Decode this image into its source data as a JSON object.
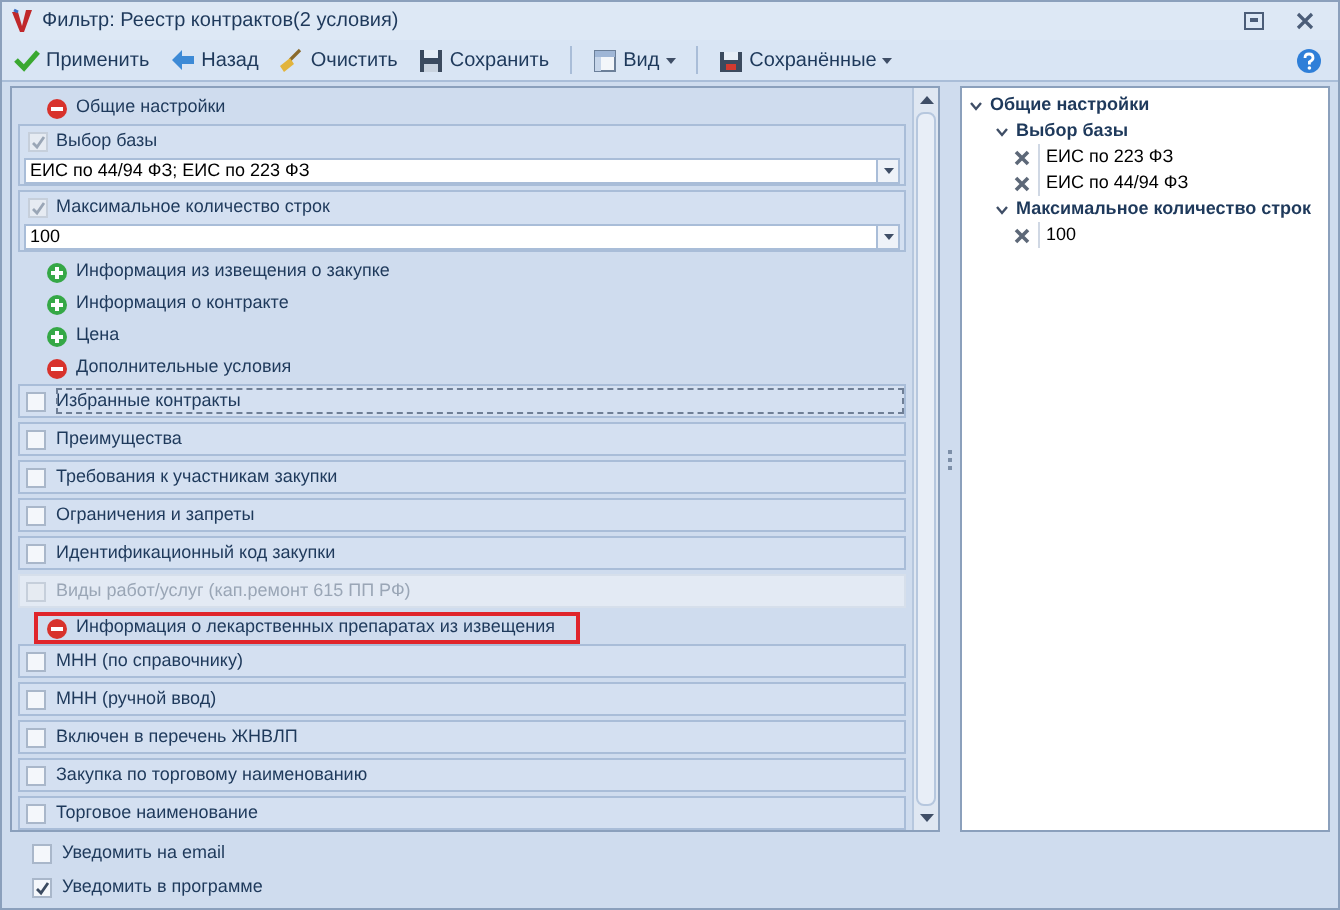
{
  "window": {
    "title": "Фильтр: Реестр контрактов(2 условия)"
  },
  "toolbar": [
    {
      "kind": "apply",
      "label": "Применить"
    },
    {
      "kind": "back",
      "label": "Назад"
    },
    {
      "kind": "clear",
      "label": "Очистить"
    },
    {
      "kind": "save",
      "label": "Сохранить"
    },
    {
      "kind": "view",
      "label": "Вид",
      "dropdown": true
    },
    {
      "kind": "saved",
      "label": "Сохранённые",
      "dropdown": true
    }
  ],
  "filters": [
    {
      "kind": "header",
      "label": "Общие настройки",
      "expanded": true,
      "highlighted": false
    },
    {
      "kind": "group",
      "label": "Выбор базы",
      "checked": true,
      "value": "ЕИС по 44/94 ФЗ; ЕИС по 223 ФЗ"
    },
    {
      "kind": "group",
      "label": "Максимальное количество строк",
      "checked": true,
      "value": "100"
    },
    {
      "kind": "header",
      "label": "Информация из извещения о закупке",
      "expanded": false,
      "highlighted": false
    },
    {
      "kind": "header",
      "label": "Информация о контракте",
      "expanded": false,
      "highlighted": false
    },
    {
      "kind": "header",
      "label": "Цена",
      "expanded": false,
      "highlighted": false
    },
    {
      "kind": "header",
      "label": "Дополнительные условия",
      "expanded": true,
      "highlighted": false
    },
    {
      "kind": "check",
      "label": "Избранные контракты",
      "checked": false,
      "disabled": false,
      "focused": true
    },
    {
      "kind": "check",
      "label": "Преимущества",
      "checked": false,
      "disabled": false,
      "focused": false
    },
    {
      "kind": "check",
      "label": "Требования к участникам закупки",
      "checked": false,
      "disabled": false,
      "focused": false
    },
    {
      "kind": "check",
      "label": "Ограничения и запреты",
      "checked": false,
      "disabled": false,
      "focused": false
    },
    {
      "kind": "check",
      "label": "Идентификационный код закупки",
      "checked": false,
      "disabled": false,
      "focused": false
    },
    {
      "kind": "check",
      "label": "Виды работ/услуг (кап.ремонт 615 ПП РФ)",
      "checked": false,
      "disabled": true,
      "focused": false
    },
    {
      "kind": "header",
      "label": "Информация о лекарственных препаратах из извещения",
      "expanded": true,
      "highlighted": true
    },
    {
      "kind": "check",
      "label": "МНН (по справочнику)",
      "checked": false,
      "disabled": false,
      "focused": false
    },
    {
      "kind": "check",
      "label": "МНН (ручной ввод)",
      "checked": false,
      "disabled": false,
      "focused": false
    },
    {
      "kind": "check",
      "label": "Включен в перечень ЖНВЛП",
      "checked": false,
      "disabled": false,
      "focused": false
    },
    {
      "kind": "check",
      "label": "Закупка по торговому наименованию",
      "checked": false,
      "disabled": false,
      "focused": false
    },
    {
      "kind": "check",
      "label": "Торговое наименование",
      "checked": false,
      "disabled": false,
      "focused": false
    }
  ],
  "summary_tree": [
    {
      "label": "Общие настройки",
      "expanded": true,
      "children": [
        {
          "label": "Выбор базы",
          "expanded": true,
          "children": [
            {
              "label": "ЕИС по 223 ФЗ"
            },
            {
              "label": "ЕИС по 44/94 ФЗ"
            }
          ]
        },
        {
          "label": "Максимальное количество строк",
          "expanded": true,
          "children": [
            {
              "label": "100"
            }
          ]
        }
      ]
    }
  ],
  "notifications": [
    {
      "label": "Уведомить на email",
      "checked": false
    },
    {
      "label": "Уведомить в программе",
      "checked": true
    }
  ]
}
